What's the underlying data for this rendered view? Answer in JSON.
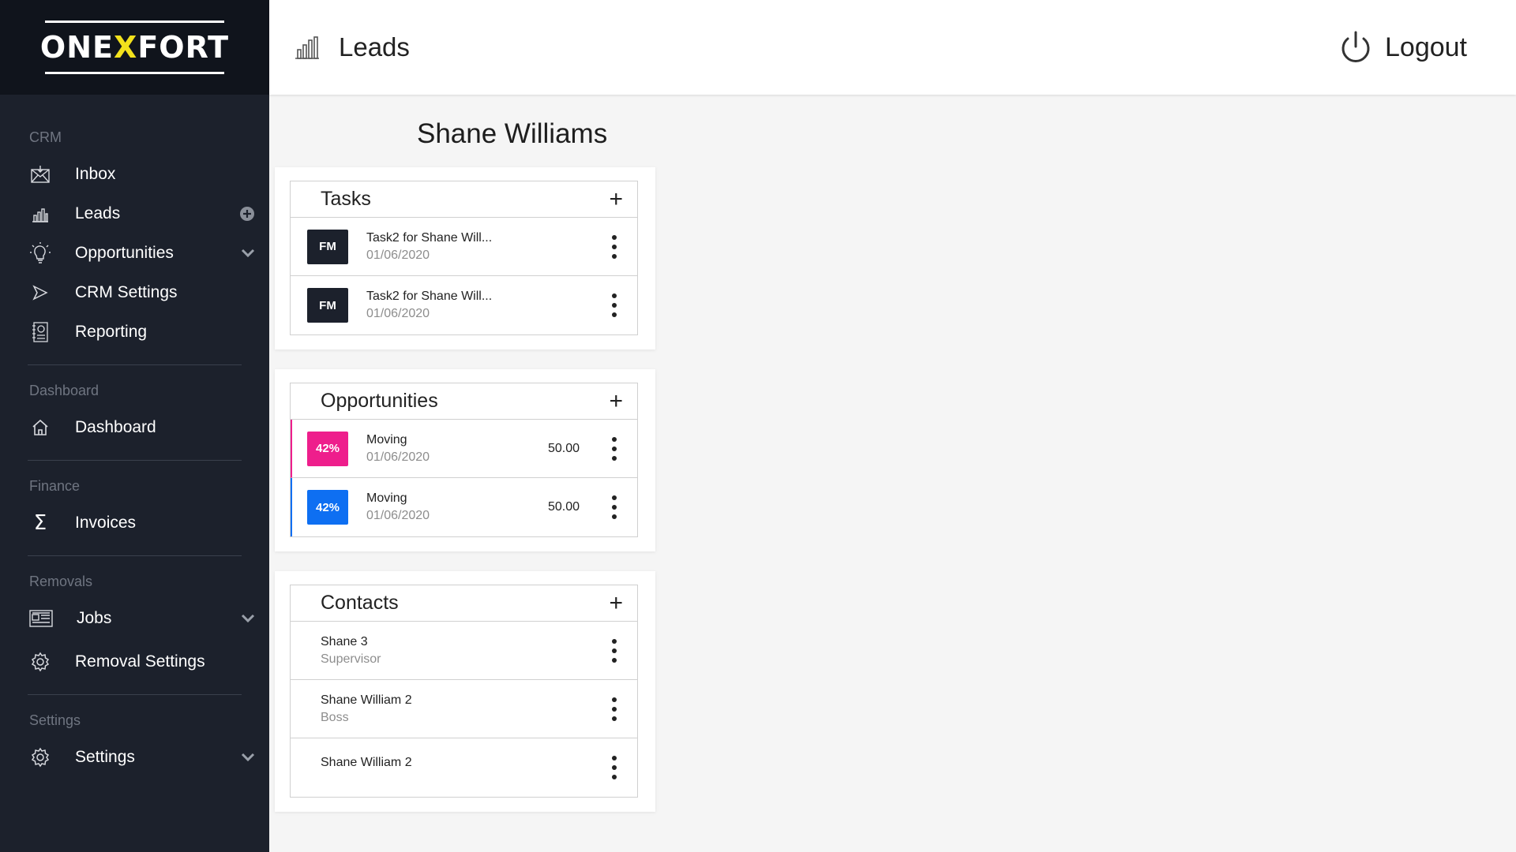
{
  "brand": {
    "logo_left": "ONE",
    "logo_x": "X",
    "logo_right": "FORT",
    "accent": "#f2e11c"
  },
  "sidebar": {
    "sections": [
      {
        "label": "CRM",
        "items": [
          "Inbox",
          "Leads",
          "Opportunities",
          "CRM Settings",
          "Reporting"
        ]
      },
      {
        "label": "Dashboard",
        "items": [
          "Dashboard"
        ]
      },
      {
        "label": "Finance",
        "items": [
          "Invoices"
        ]
      },
      {
        "label": "Removals",
        "items": [
          "Jobs",
          "Removal Settings"
        ]
      },
      {
        "label": "Settings",
        "items": [
          "Settings"
        ]
      }
    ]
  },
  "header": {
    "title": "Leads",
    "logout_label": "Logout"
  },
  "person": {
    "name": "Shane Williams"
  },
  "tasks": {
    "title": "Tasks",
    "add_label": "+",
    "items": [
      {
        "badge": "FM",
        "title": "Task2 for Shane Will...",
        "date": "01/06/2020"
      },
      {
        "badge": "FM",
        "title": "Task2 for Shane Will...",
        "date": "01/06/2020"
      }
    ]
  },
  "opportunities": {
    "title": "Opportunities",
    "add_label": "+",
    "items": [
      {
        "badge": "42%",
        "title": "Moving",
        "date": "01/06/2020",
        "amount": "50.00",
        "color": "#ee1e8c"
      },
      {
        "badge": "42%",
        "title": "Moving",
        "date": "01/06/2020",
        "amount": "50.00",
        "color": "#0e6ff2"
      }
    ]
  },
  "contacts": {
    "title": "Contacts",
    "add_label": "+",
    "items": [
      {
        "name": "Shane 3",
        "role": "Supervisor"
      },
      {
        "name": "Shane William 2",
        "role": "Boss"
      },
      {
        "name": "Shane William 2",
        "role": ""
      }
    ]
  },
  "colors": {
    "sidebar_bg": "#1c212c",
    "logo_bg": "#10141c",
    "task_badge": "#1c212c"
  }
}
